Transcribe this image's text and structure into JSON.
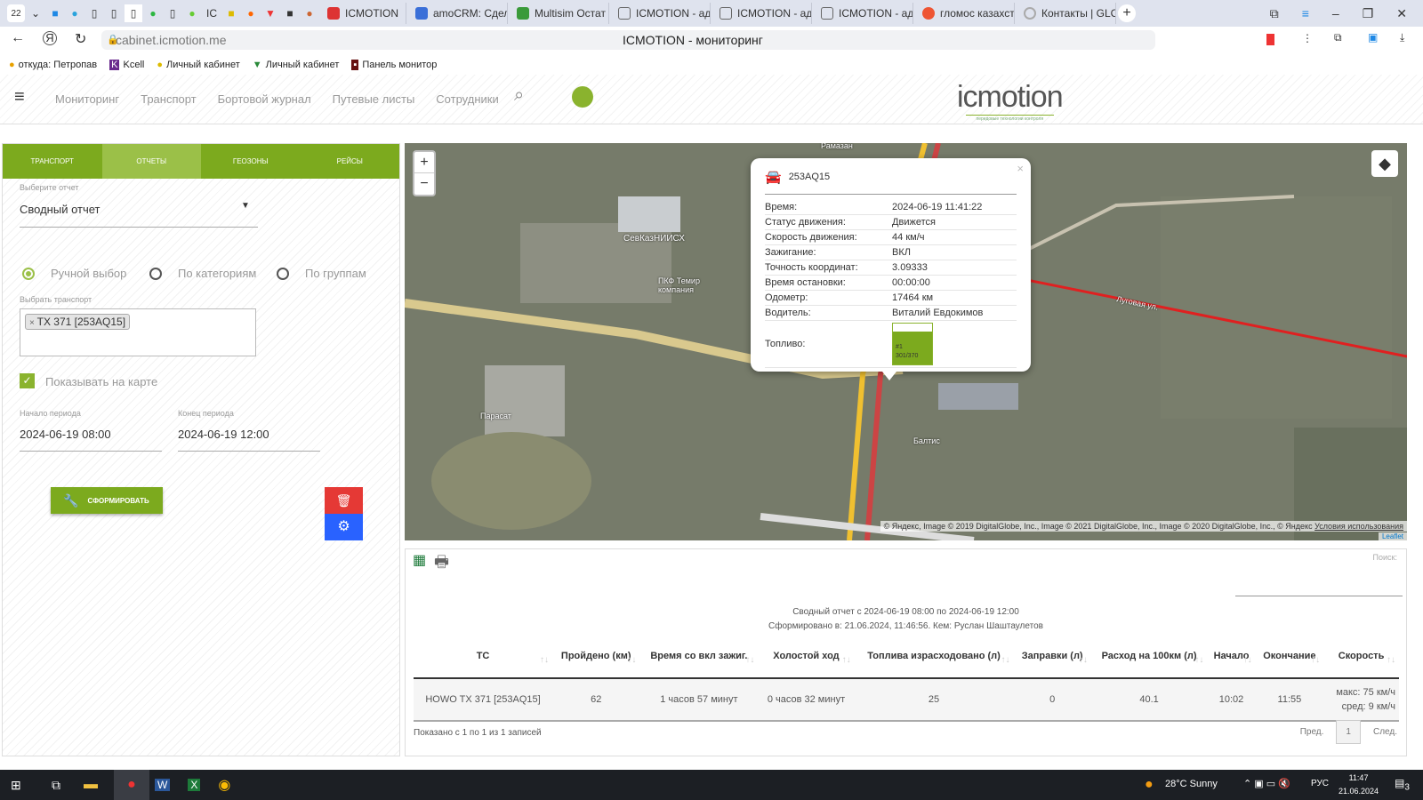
{
  "browser": {
    "tab_count": "22",
    "tabs": [
      {
        "label": "ICMOTION",
        "color": "#d33"
      },
      {
        "label": "amoCRM: Сдел",
        "color": "#3a6fd8"
      },
      {
        "label": "Multisim Остат",
        "color": "#3a9a3a"
      },
      {
        "label": "ICMOTION - ад",
        "color": "#999"
      },
      {
        "label": "ICMOTION - ад",
        "color": "#999"
      },
      {
        "label": "ICMOTION - ад",
        "color": "#999"
      },
      {
        "label": "гломос казахст",
        "color": "#e53"
      },
      {
        "label": "Контакты | GLC",
        "color": "#aaa"
      }
    ],
    "url": "cabinet.icmotion.me",
    "page_title": "ICMOTION - мониторинг",
    "bookmarks": [
      "откуда: Петропав",
      "Kcell",
      "Личный кабинет",
      "Личный кабинет",
      "Панель монитор"
    ]
  },
  "header": {
    "nav": [
      "Мониторинг",
      "Транспорт",
      "Бортовой журнал",
      "Путевые листы",
      "Сотрудники"
    ],
    "logo": "icmotion",
    "logo_tagline": "передовые технологии контроля"
  },
  "left": {
    "tabs": [
      "Транспорт",
      "Отчеты",
      "Геозоны",
      "Рейсы"
    ],
    "report_label": "Выберите отчет",
    "report_value": "Сводный отчет",
    "radios": [
      "Ручной выбор",
      "По категориям",
      "По группам"
    ],
    "transport_label": "Выбрать транспорт",
    "transport_tag": "TX 371 [253AQ15]",
    "show_on_map": "Показывать на карте",
    "start_label": "Начало периода",
    "start_value": "2024-06-19 08:00",
    "end_label": "Конец периода",
    "end_value": "2024-06-19 12:00",
    "generate": "Сформировать"
  },
  "map": {
    "labels": [
      "СевКазНИИСХ",
      "ПКФ Темир компания",
      "Парасат",
      "Балтис",
      "Рамазан",
      "Луговая ул."
    ],
    "attribution": "© Яндекс, Image © 2019 DigitalGlobe, Inc., Image © 2021 DigitalGlobe, Inc., Image © 2020 DigitalGlobe, Inc., © Яндекс",
    "terms": "Условия использования",
    "leaflet": "Leaflet",
    "popup": {
      "vehicle": "253AQ15",
      "rows": [
        [
          "Время:",
          "2024-06-19 11:41:22"
        ],
        [
          "Статус движения:",
          "Движется"
        ],
        [
          "Скорость движения:",
          "44 км/ч"
        ],
        [
          "Зажигание:",
          "ВКЛ"
        ],
        [
          "Точность координат:",
          "3.09333"
        ],
        [
          "Время остановки:",
          "00:00:00"
        ],
        [
          "Одометр:",
          "17464 км"
        ],
        [
          "Водитель:",
          "Виталий Евдокимов"
        ]
      ],
      "fuel_label": "Топливо:",
      "fuel_tank": "#1",
      "fuel_value": "301/370",
      "fuel_fraction": 0.81
    }
  },
  "report": {
    "search_label": "Поиск:",
    "title": "Сводный отчет с 2024-06-19 08:00 по 2024-06-19 12:00",
    "subtitle": "Сформировано в: 21.06.2024, 11:46:56. Кем: Руслан Шаштаулетов",
    "columns": [
      "ТС",
      "Пройдено (км)",
      "Время со вкл зажиг.",
      "Холостой ход",
      "Топлива израсходовано (л)",
      "Заправки (л)",
      "Расход на 100км (л)",
      "Начало",
      "Окончание",
      "Скорость"
    ],
    "rows": [
      [
        "HOWO TX 371 [253AQ15]",
        "62",
        "1 часов 57 минут",
        "0 часов 32 минут",
        "25",
        "0",
        "40.1",
        "10:02",
        "11:55",
        "макс: 75 км/ч",
        "сред: 9 км/ч"
      ]
    ],
    "info": "Показано с 1 по 1 из 1 записей",
    "prev": "Пред.",
    "page": "1",
    "next": "След."
  },
  "taskbar": {
    "weather": "28°C  Sunny",
    "lang": "РУС",
    "time": "11:47",
    "date": "21.06.2024",
    "notif": "3"
  }
}
